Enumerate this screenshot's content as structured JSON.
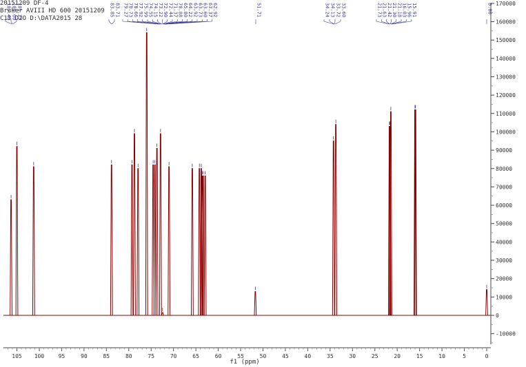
{
  "header_lines": [
    "20151209 DF-4",
    "Bruker AVIII HD 600 20151209",
    "C13 D2O D:\\DATA2015 28"
  ],
  "colors": {
    "spectrum": "#8b0000",
    "peak_label": "#3a3aa0",
    "axis": "#444444"
  },
  "chart_data": {
    "type": "line",
    "title": "",
    "xlabel": "f1 (ppm)",
    "ylabel": "",
    "xlim": [
      107.5,
      -1.5
    ],
    "ylim": [
      -17000,
      170000
    ],
    "x_ticks": [
      105,
      100,
      95,
      90,
      85,
      80,
      75,
      70,
      65,
      60,
      55,
      50,
      45,
      40,
      35,
      30,
      25,
      20,
      15,
      10,
      5,
      0
    ],
    "y_ticks": [
      -10000,
      0,
      10000,
      20000,
      30000,
      40000,
      50000,
      60000,
      70000,
      80000,
      90000,
      100000,
      110000,
      120000,
      130000,
      140000,
      150000,
      160000,
      170000
    ],
    "peaks": [
      {
        "ppm": 106.3,
        "height": 63000
      },
      {
        "ppm": 105.0,
        "height": 92000
      },
      {
        "ppm": 101.25,
        "height": 81000
      },
      {
        "ppm": 83.85,
        "height": 82000
      },
      {
        "ppm": 79.27,
        "height": 82000
      },
      {
        "ppm": 78.73,
        "height": 99000
      },
      {
        "ppm": 77.92,
        "height": 80000
      },
      {
        "ppm": 75.99,
        "height": 154000
      },
      {
        "ppm": 74.55,
        "height": 82000
      },
      {
        "ppm": 74.15,
        "height": 82000
      },
      {
        "ppm": 73.7,
        "height": 91000
      },
      {
        "ppm": 72.9,
        "height": 99000
      },
      {
        "ppm": 72.44,
        "height": 1500
      },
      {
        "ppm": 71.0,
        "height": 81000
      },
      {
        "ppm": 65.8,
        "height": 80000
      },
      {
        "ppm": 64.22,
        "height": 80000
      },
      {
        "ppm": 63.8,
        "height": 80000
      },
      {
        "ppm": 63.6,
        "height": 76000
      },
      {
        "ppm": 63.37,
        "height": 76000
      },
      {
        "ppm": 62.92,
        "height": 76000
      },
      {
        "ppm": 51.71,
        "height": 13000
      },
      {
        "ppm": 34.24,
        "height": 95000
      },
      {
        "ppm": 33.72,
        "height": 104000
      },
      {
        "ppm": 21.73,
        "height": 103000
      },
      {
        "ppm": 21.63,
        "height": 103000
      },
      {
        "ppm": 21.42,
        "height": 111000
      },
      {
        "ppm": 16.03,
        "height": 112000
      },
      {
        "ppm": 15.91,
        "height": 112000
      },
      {
        "ppm": 0.0,
        "height": 14000
      }
    ],
    "peak_labels": {
      "left_cluster": [
        "105.48",
        "105.00",
        "101.25"
      ],
      "group_a": [
        "83.85",
        "83.71"
      ],
      "group_b": [
        "79.27",
        "78.73",
        "78.66",
        "77.92",
        "75.99",
        "74.55",
        "74.15",
        "73.22",
        "72.90",
        "72.44",
        "71.37",
        "70.88",
        "65.80",
        "64.22",
        "63.92",
        "63.73",
        "63.60",
        "63.37",
        "62.92"
      ],
      "single_51": [
        "51.71"
      ],
      "group_c": [
        "34.24",
        "34.13",
        "33.72",
        "33.60"
      ],
      "group_d": [
        "21.73",
        "21.63",
        "21.42",
        "21.30",
        "21.18",
        "16.03",
        "15.96",
        "15.91"
      ],
      "single_0": [
        "0.00"
      ]
    }
  }
}
